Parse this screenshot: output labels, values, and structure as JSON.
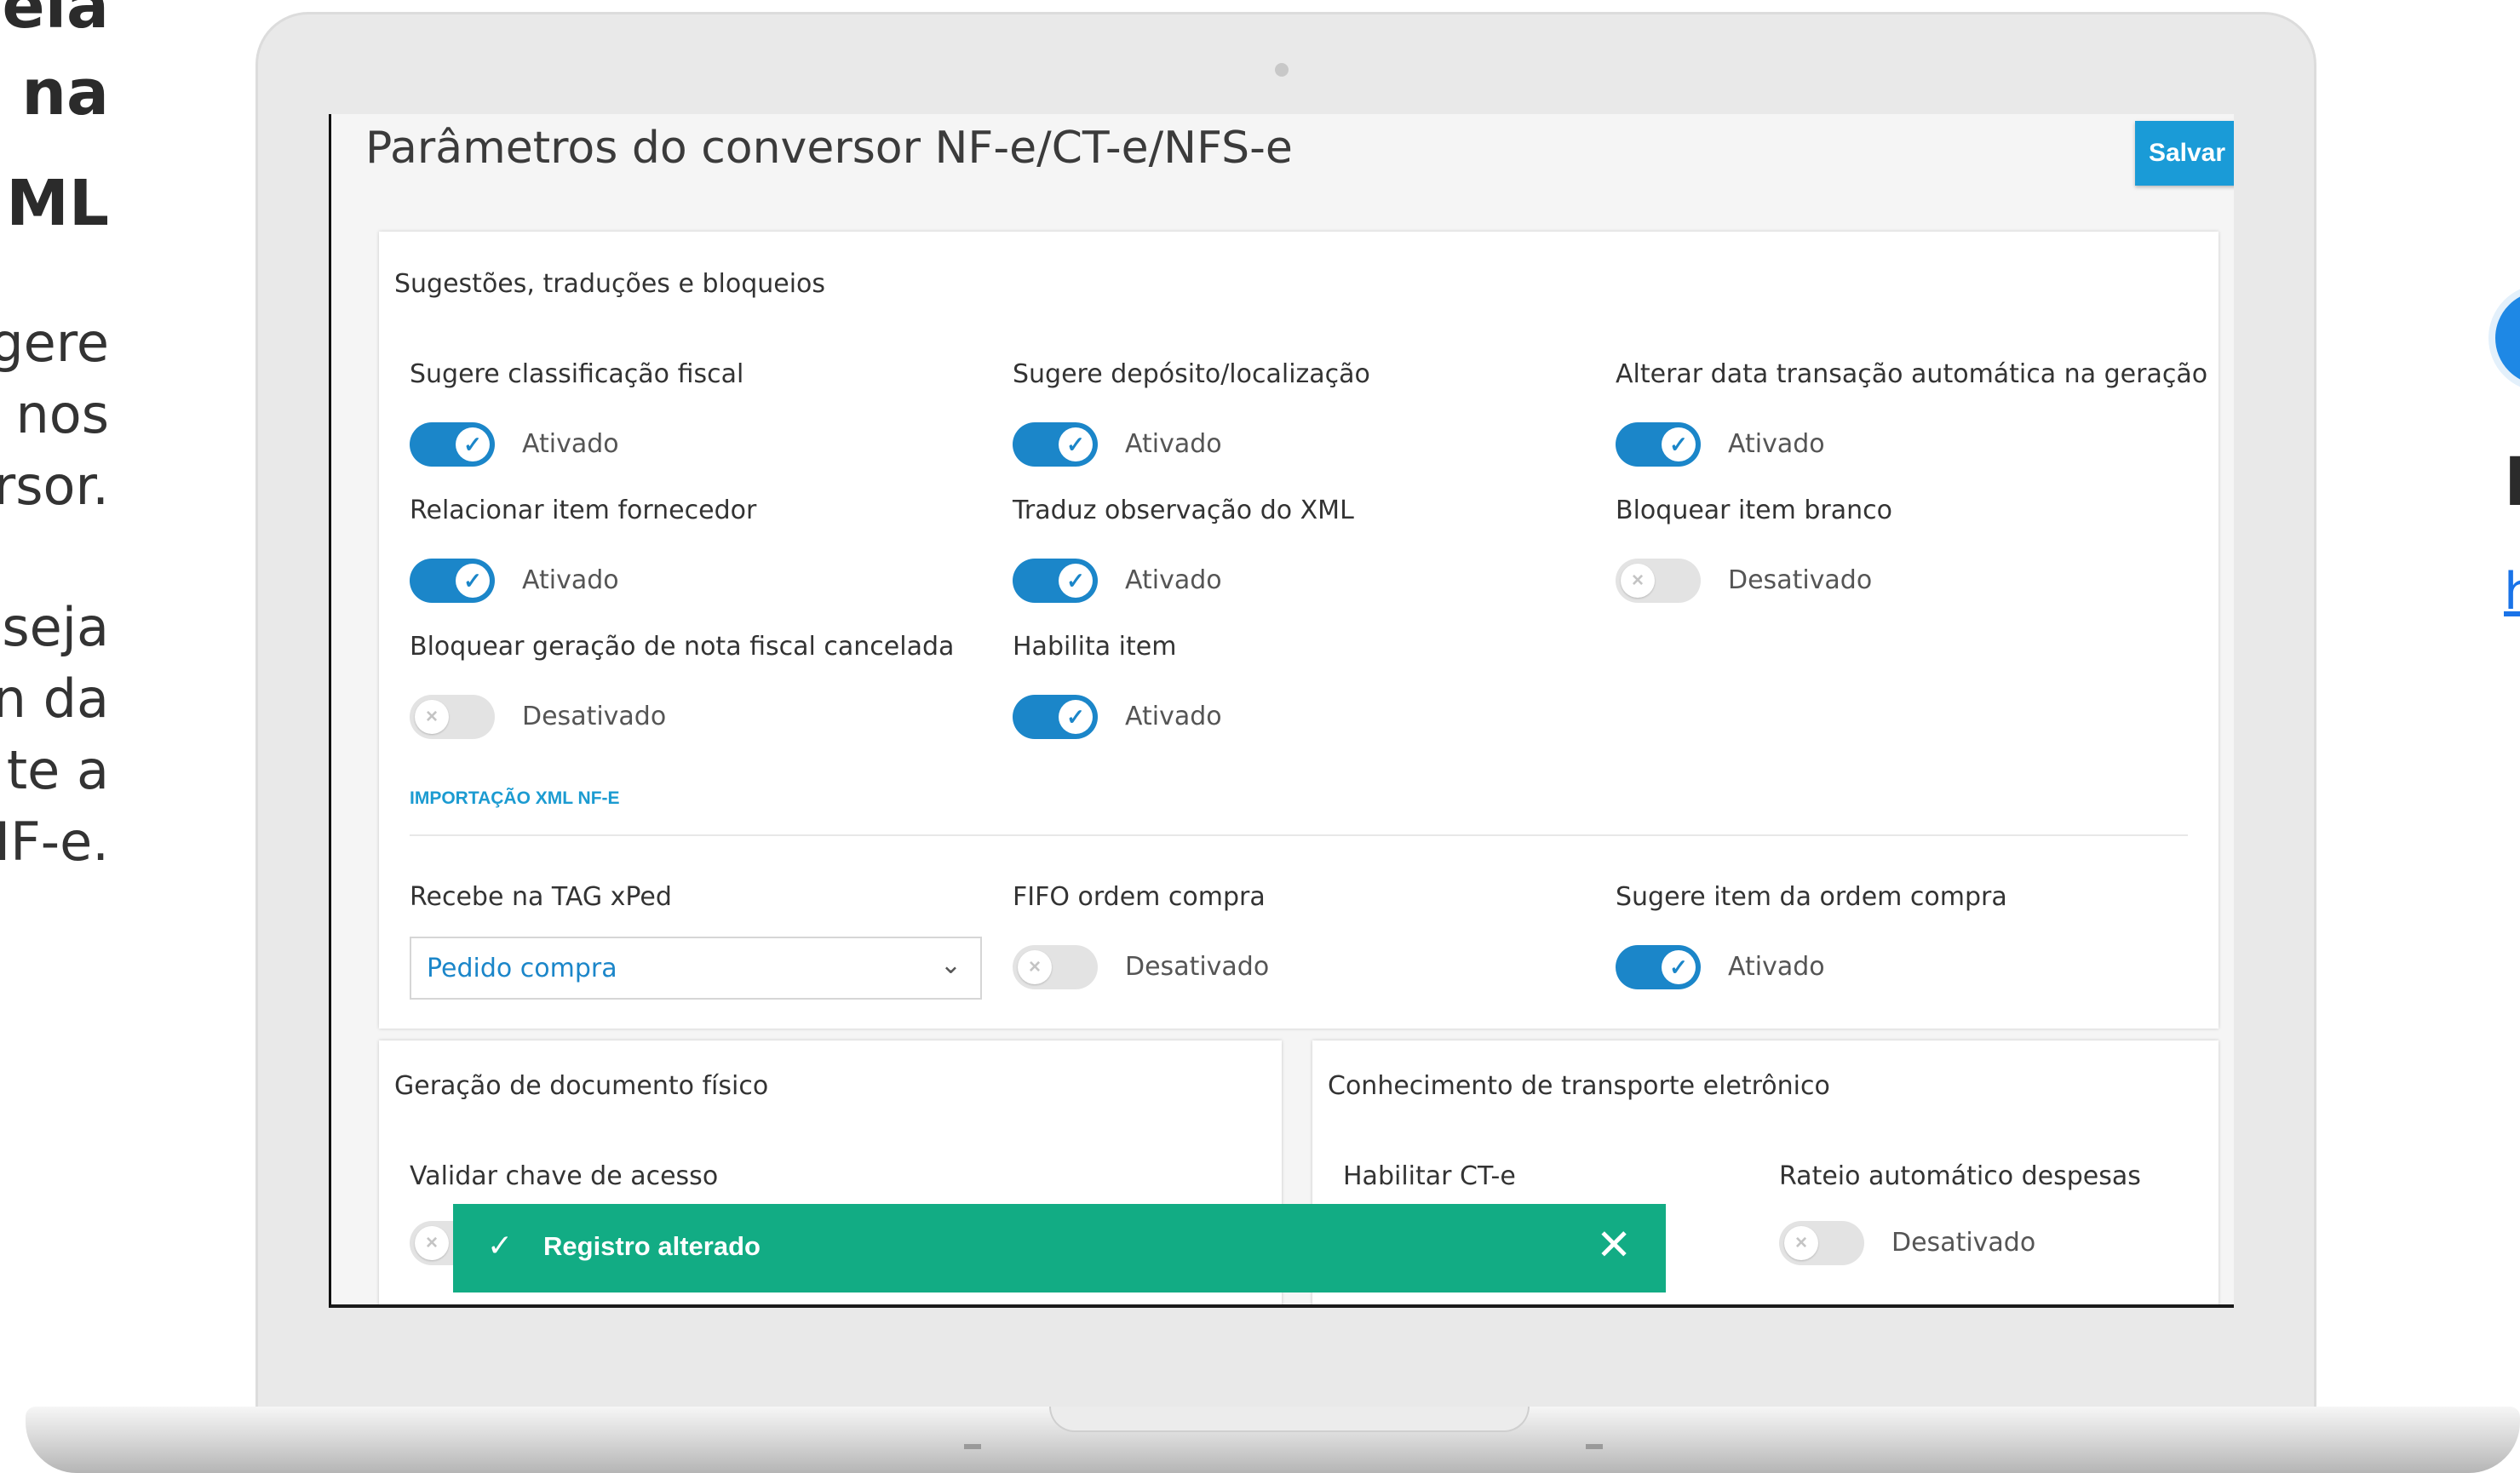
{
  "left_panel": {
    "title_lines": [
      "ela",
      "na",
      "ML"
    ],
    "body_lines": [
      "gere",
      "nos",
      "rsor.",
      "seja",
      "n da",
      "te a",
      "IF-e."
    ]
  },
  "right_panel": {
    "letter": "I",
    "link": "h"
  },
  "app": {
    "page_title": "Parâmetros do conversor NF-e/CT-e/NFS-e",
    "save_label": "Salvar",
    "card1": {
      "title": "Sugestões, traduções e bloqueios",
      "fields": [
        {
          "label": "Sugere classificação fiscal",
          "state": "Ativado",
          "on": true
        },
        {
          "label": "Sugere depósito/localização",
          "state": "Ativado",
          "on": true
        },
        {
          "label": "Alterar data transação automática na geração",
          "state": "Ativado",
          "on": true
        },
        {
          "label": "Relacionar item fornecedor",
          "state": "Ativado",
          "on": true
        },
        {
          "label": "Traduz observação do XML",
          "state": "Ativado",
          "on": true
        },
        {
          "label": "Bloquear item branco",
          "state": "Desativado",
          "on": false
        },
        {
          "label": "Bloquear geração de nota fiscal cancelada",
          "state": "Desativado",
          "on": false
        },
        {
          "label": "Habilita item",
          "state": "Ativado",
          "on": true
        }
      ],
      "section_heading": "IMPORTAÇÃO XML NF-E",
      "xml_fields": {
        "tag_label": "Recebe na TAG xPed",
        "tag_value": "Pedido compra",
        "fifo_label": "FIFO ordem compra",
        "fifo_state": "Desativado",
        "suggest_label": "Sugere item da ordem compra",
        "suggest_state": "Ativado"
      }
    },
    "card2": {
      "title": "Geração de documento físico",
      "field_label": "Validar chave de acesso"
    },
    "card3": {
      "title": "Conhecimento de transporte eletrônico",
      "field1_label": "Habilitar CT-e",
      "field2_label": "Rateio automático despesas",
      "field2_state": "Desativado"
    },
    "toast": {
      "message": "Registro alterado"
    }
  }
}
